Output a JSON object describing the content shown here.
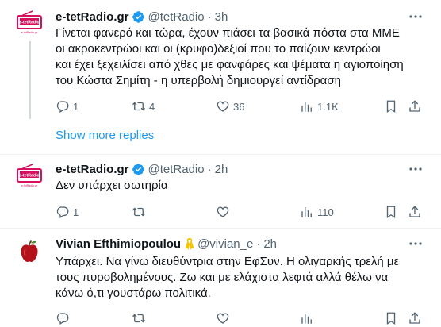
{
  "tweets": [
    {
      "name": "e-tetRadio.gr",
      "handle": "@tetRadio",
      "separator": "·",
      "time": "3h",
      "avatar_text": "e-tetRadio",
      "avatar_subtext": "e-tetRadio.gr",
      "text_lines": [
        "Γίνεται φανερό και τώρα, έχουν πιάσει τα βασικά πόστα στα ΜΜΕ",
        "οι ακροκεντρώοι και οι (κρυφο)δεξιοί που το παίζουν κεντρώοι",
        "και έχει ξεχειλίσει από χθες με φανφάρες και ψέματα η αγιοποίηση",
        "του Κώστα Σημίτη - η υπερβολή δημιουργεί αντίδραση"
      ],
      "replies": "1",
      "retweets": "4",
      "likes": "36",
      "views": "1.1K"
    },
    {
      "name": "e-tetRadio.gr",
      "handle": "@tetRadio",
      "separator": "·",
      "time": "2h",
      "avatar_text": "e-tetRadio",
      "avatar_subtext": "e-tetRadio.gr",
      "text_lines": [
        "Δεν υπάρχει σωτηρία"
      ],
      "replies": "1",
      "retweets": "",
      "likes": "",
      "views": "110"
    },
    {
      "name": "Vivian Efthimiopoulou",
      "handle": "@vivian_e",
      "separator": "·",
      "time": "2h",
      "text_lines": [
        "Υπάρχει. Να γίνω διευθύντρια στην ΕφΣυν. Η ολιγαρκής τρελή με",
        "τους πυροβολημένους. Ζω και με ελάχιστα λεφτά αλλά θέλω να",
        "κάνω ό,τι γουστάρω πολιτικά."
      ],
      "replies": "",
      "retweets": "",
      "likes": "",
      "views": ""
    }
  ],
  "show_more_replies": "Show more replies",
  "colors": {
    "accent": "#1d9bf0",
    "brand_red": "#d6105e",
    "secondary_text": "#536471",
    "ribbon": "#f5c400"
  },
  "icons": [
    "verified-badge-icon",
    "more-options-icon",
    "reply-icon",
    "retweet-icon",
    "like-icon",
    "views-icon",
    "bookmark-icon",
    "share-icon",
    "ribbon-icon",
    "apple-avatar-icon"
  ]
}
